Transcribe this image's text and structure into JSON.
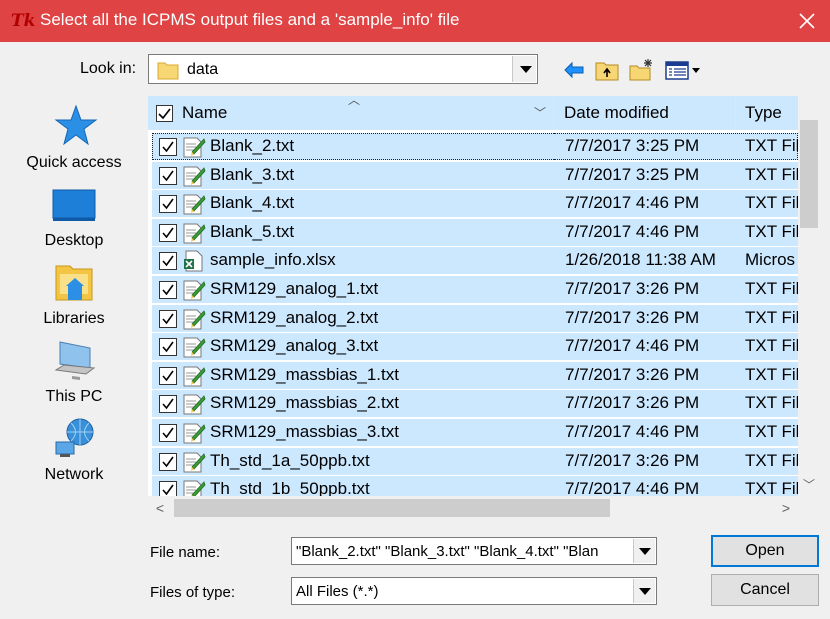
{
  "window": {
    "title": "Select all the ICPMS output files and a 'sample_info' file",
    "app_icon": "Tk"
  },
  "toolbar": {
    "look_in_label": "Look in:",
    "look_in_value": "data"
  },
  "places": [
    {
      "label": "Quick access",
      "icon": "star-icon"
    },
    {
      "label": "Desktop",
      "icon": "desktop-icon"
    },
    {
      "label": "Libraries",
      "icon": "libraries-icon"
    },
    {
      "label": "This PC",
      "icon": "computer-icon"
    },
    {
      "label": "Network",
      "icon": "network-icon"
    }
  ],
  "columns": {
    "name": "Name",
    "date": "Date modified",
    "type": "Type"
  },
  "files": [
    {
      "name": "Blank_2.txt",
      "date": "7/7/2017 3:25 PM",
      "type": "TXT Fil",
      "icon": "text-file-icon"
    },
    {
      "name": "Blank_3.txt",
      "date": "7/7/2017 3:25 PM",
      "type": "TXT Fil",
      "icon": "text-file-icon"
    },
    {
      "name": "Blank_4.txt",
      "date": "7/7/2017 4:46 PM",
      "type": "TXT Fil",
      "icon": "text-file-icon"
    },
    {
      "name": "Blank_5.txt",
      "date": "7/7/2017 4:46 PM",
      "type": "TXT Fil",
      "icon": "text-file-icon"
    },
    {
      "name": "sample_info.xlsx",
      "date": "1/26/2018 11:38 AM",
      "type": "Micros",
      "icon": "excel-file-icon"
    },
    {
      "name": "SRM129_analog_1.txt",
      "date": "7/7/2017 3:26 PM",
      "type": "TXT Fil",
      "icon": "text-file-icon"
    },
    {
      "name": "SRM129_analog_2.txt",
      "date": "7/7/2017 3:26 PM",
      "type": "TXT Fil",
      "icon": "text-file-icon"
    },
    {
      "name": "SRM129_analog_3.txt",
      "date": "7/7/2017 4:46 PM",
      "type": "TXT Fil",
      "icon": "text-file-icon"
    },
    {
      "name": "SRM129_massbias_1.txt",
      "date": "7/7/2017 3:26 PM",
      "type": "TXT Fil",
      "icon": "text-file-icon"
    },
    {
      "name": "SRM129_massbias_2.txt",
      "date": "7/7/2017 3:26 PM",
      "type": "TXT Fil",
      "icon": "text-file-icon"
    },
    {
      "name": "SRM129_massbias_3.txt",
      "date": "7/7/2017 4:46 PM",
      "type": "TXT Fil",
      "icon": "text-file-icon"
    },
    {
      "name": "Th_std_1a_50ppb.txt",
      "date": "7/7/2017 3:26 PM",
      "type": "TXT Fil",
      "icon": "text-file-icon"
    },
    {
      "name": "Th_std_1b_50ppb.txt",
      "date": "7/7/2017 4:46 PM",
      "type": "TXT Fil",
      "icon": "text-file-icon"
    }
  ],
  "footer": {
    "file_name_label": "File name:",
    "file_name_value": "\"Blank_2.txt\" \"Blank_3.txt\" \"Blank_4.txt\" \"Blan",
    "file_type_label": "Files of type:",
    "file_type_value": "All Files (*.*)",
    "open_label": "Open",
    "cancel_label": "Cancel"
  },
  "colors": {
    "titlebar": "#e04343",
    "selection": "#cce8ff",
    "accent": "#0078d7"
  }
}
